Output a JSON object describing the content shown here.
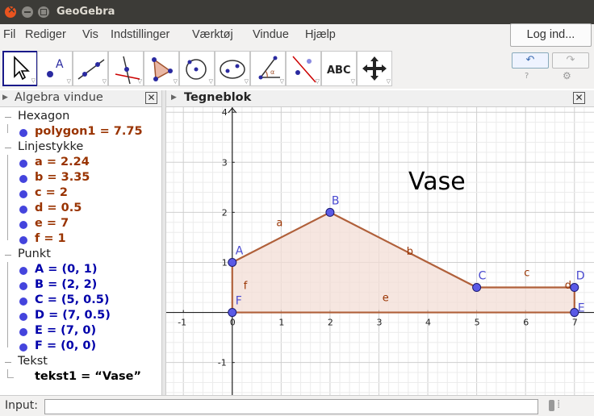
{
  "window": {
    "title": "GeoGebra"
  },
  "menu": {
    "items": [
      "Fil",
      "Rediger",
      "Vis",
      "Indstillinger",
      "Værktøj",
      "Vindue",
      "Hjælp"
    ],
    "login_label": "Log ind..."
  },
  "toolbar": {
    "tool_names": [
      "move-tool",
      "point-tool",
      "line-tool",
      "perpendicular-line-tool",
      "polygon-tool",
      "circle-center-point-tool",
      "conic-tool",
      "angle-tool",
      "reflect-tool",
      "text-tool",
      "move-graphics-view-tool"
    ],
    "text_tool_label": "ABC",
    "undo_label": "↶",
    "redo_label": "↷"
  },
  "algebra": {
    "title": "Algebra vindue",
    "categories": [
      {
        "name": "Hexagon",
        "items": [
          {
            "text": "polygon1 = 7.75",
            "color": "#993300"
          }
        ]
      },
      {
        "name": "Linjestykke",
        "items": [
          {
            "text": "a = 2.24",
            "color": "#993300"
          },
          {
            "text": "b = 3.35",
            "color": "#993300"
          },
          {
            "text": "c = 2",
            "color": "#993300"
          },
          {
            "text": "d = 0.5",
            "color": "#993300"
          },
          {
            "text": "e = 7",
            "color": "#993300"
          },
          {
            "text": "f = 1",
            "color": "#993300"
          }
        ]
      },
      {
        "name": "Punkt",
        "items": [
          {
            "text": "A = (0,  1)",
            "color": "#0000aa"
          },
          {
            "text": "B = (2,  2)",
            "color": "#0000aa"
          },
          {
            "text": "C = (5,  0.5)",
            "color": "#0000aa"
          },
          {
            "text": "D = (7,  0.5)",
            "color": "#0000aa"
          },
          {
            "text": "E = (7,  0)",
            "color": "#0000aa"
          },
          {
            "text": "F = (0,  0)",
            "color": "#0000aa"
          }
        ]
      },
      {
        "name": "Tekst",
        "items": [
          {
            "text": "tekst1 = “Vase”",
            "color": "#000000"
          }
        ]
      }
    ]
  },
  "graphics": {
    "title": "Tegneblok",
    "text_label": "Vase",
    "points": [
      {
        "name": "A",
        "x": 0,
        "y": 1
      },
      {
        "name": "B",
        "x": 2,
        "y": 2
      },
      {
        "name": "C",
        "x": 5,
        "y": 0.5
      },
      {
        "name": "D",
        "x": 7,
        "y": 0.5
      },
      {
        "name": "E",
        "x": 7,
        "y": 0
      },
      {
        "name": "F",
        "x": 0,
        "y": 0
      }
    ],
    "segments": [
      {
        "name": "a",
        "from": "A",
        "to": "B"
      },
      {
        "name": "b",
        "from": "B",
        "to": "C"
      },
      {
        "name": "c",
        "from": "C",
        "to": "D"
      },
      {
        "name": "d",
        "from": "D",
        "to": "E"
      },
      {
        "name": "e",
        "from": "E",
        "to": "F"
      },
      {
        "name": "f",
        "from": "F",
        "to": "A"
      }
    ],
    "x_ticks": [
      -1,
      0,
      1,
      2,
      3,
      4,
      5,
      6,
      7
    ],
    "y_ticks": [
      4,
      3,
      2,
      1,
      -1
    ],
    "xlim": [
      -1.35,
      7.4
    ],
    "ylim": [
      -1.65,
      4.1
    ],
    "colors": {
      "polygon_stroke": "#b0603a",
      "polygon_fill": "#f3ded6",
      "point_fill": "#5a5ae6",
      "point_label": "#4a4ad0",
      "segment_label": "#993300"
    }
  },
  "input": {
    "label": "Input:",
    "value": ""
  }
}
